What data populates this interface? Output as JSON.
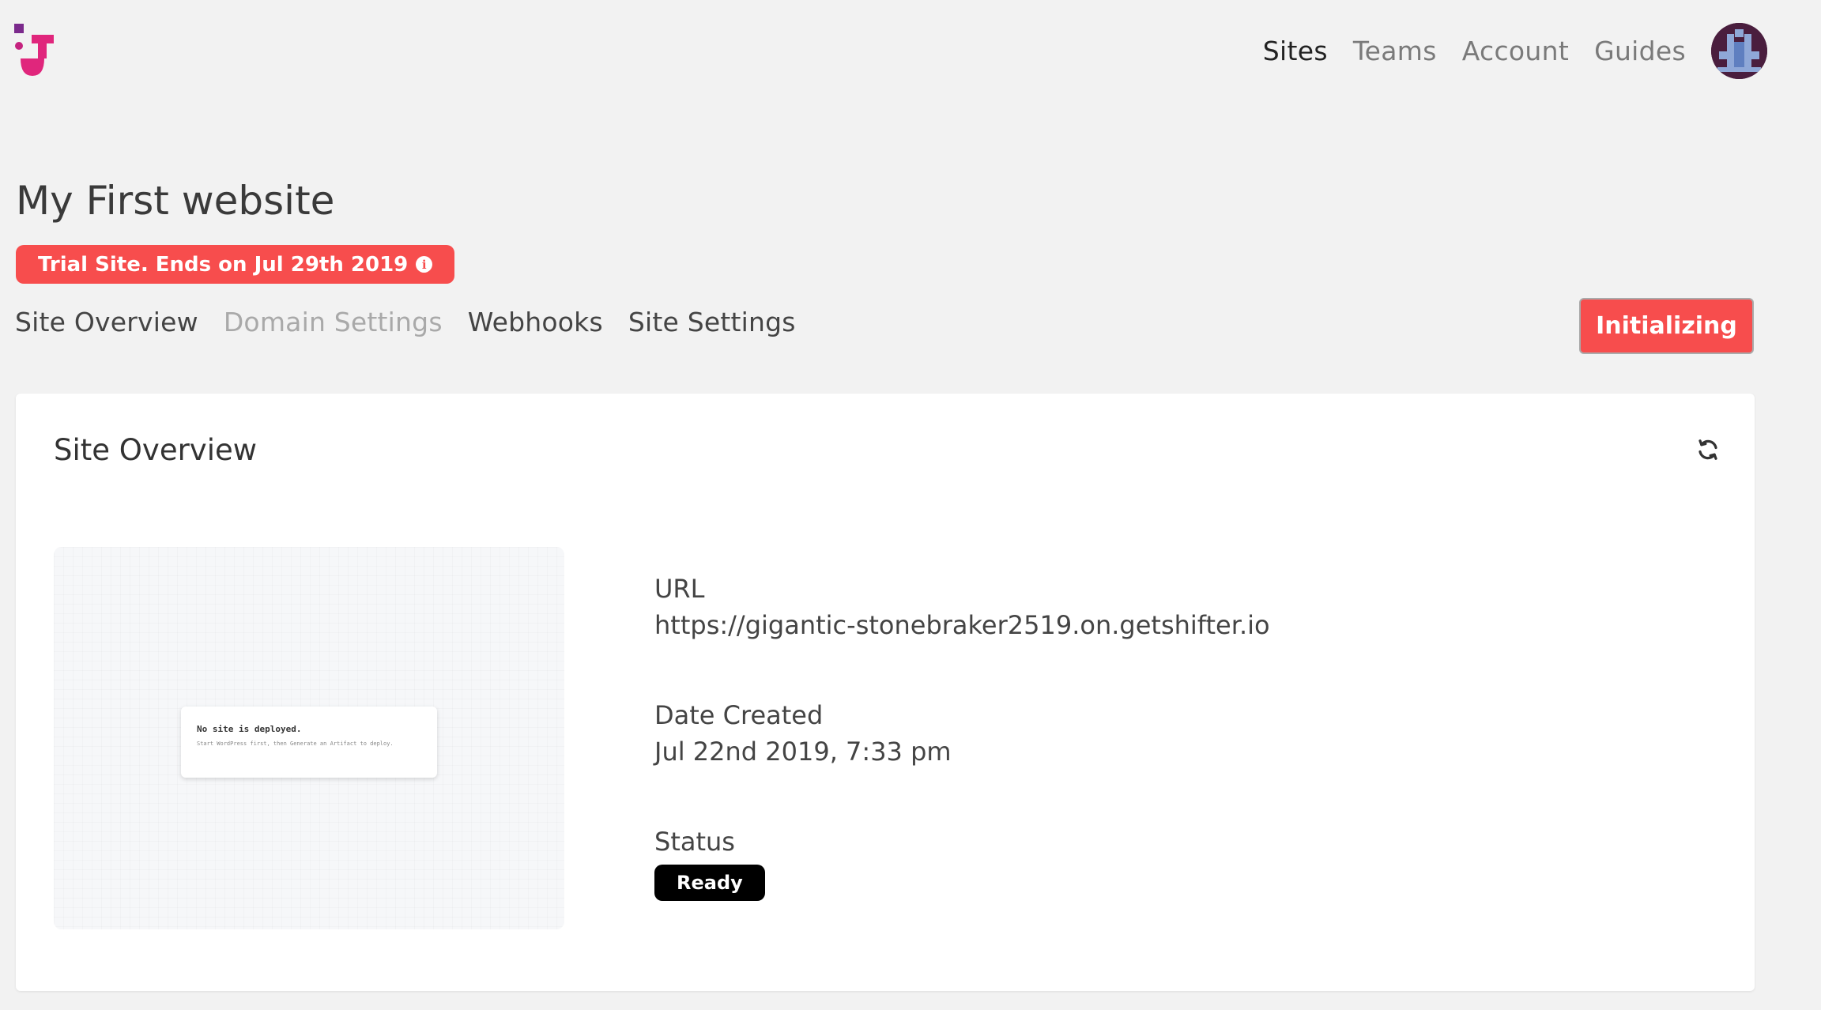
{
  "header": {
    "nav": [
      "Sites",
      "Teams",
      "Account",
      "Guides"
    ],
    "active_nav": "Sites"
  },
  "page": {
    "title": "My First website",
    "trial_badge": "Trial Site. Ends on Jul 29th 2019",
    "tabs": [
      "Site Overview",
      "Domain Settings",
      "Webhooks",
      "Site Settings"
    ],
    "status_button": "Initializing"
  },
  "overview": {
    "title": "Site Overview",
    "preview": {
      "heading": "No site is deployed.",
      "subtext": "Start WordPress first, then Generate an Artifact to deploy."
    },
    "url_label": "URL",
    "url": "https://gigantic-stonebraker2519.on.getshifter.io",
    "date_label": "Date Created",
    "date": "Jul 22nd 2019, 7:33 pm",
    "status_label": "Status",
    "status": "Ready"
  },
  "colors": {
    "accent": "#f74d4d",
    "logo": "#e0267c",
    "background": "#f2f2f2"
  },
  "icons": {
    "logo": "shifter-logo",
    "info": "info-icon",
    "refresh": "refresh-icon",
    "avatar": "avatar"
  }
}
